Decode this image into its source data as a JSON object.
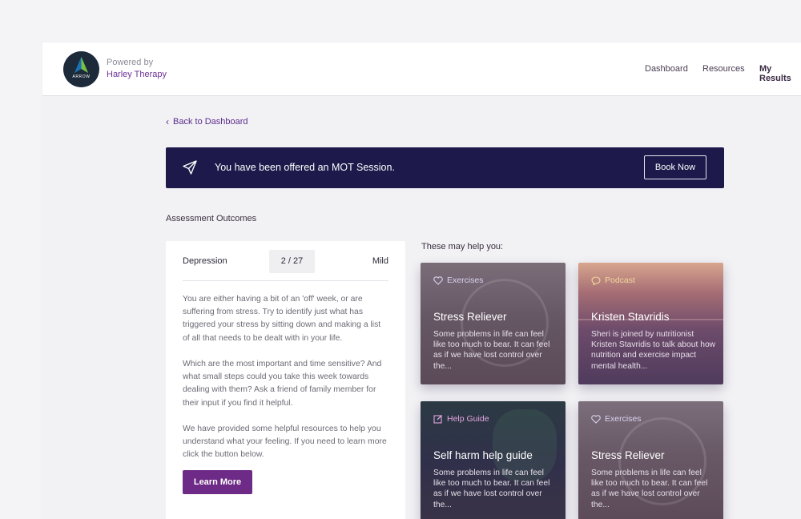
{
  "header": {
    "logo_text": "ARROW",
    "powered_by": "Powered by",
    "brand": "Harley Therapy",
    "nav": [
      {
        "label": "Dashboard"
      },
      {
        "label": "Resources"
      },
      {
        "label": "My Results"
      }
    ]
  },
  "back_link": "Back to Dashboard",
  "banner": {
    "icon": "paper-plane-icon",
    "text": "You have been offered an MOT Session.",
    "button": "Book Now"
  },
  "section_title": "Assessment Outcomes",
  "outcome": {
    "label": "Depression",
    "score": "2 / 27",
    "level": "Mild",
    "paragraphs": [
      "You are either having a bit of an 'off' week, or are suffering from stress. Try to identify just what has triggered your stress by sitting down and making a list of all that needs to be dealt with in your life.",
      "Which are the most important and time sensitive? And what small steps could you take this week towards dealing with them? Ask a friend of family member for their input if you find it helpful.",
      "We have provided some helpful resources to help you understand what your feeling. If you need to learn more click the button below."
    ],
    "button": "Learn More"
  },
  "help_title": "These may help you:",
  "resources": [
    {
      "tag": "Exercises",
      "tag_icon": "heart-icon",
      "tag_color": "#d9d3f2",
      "title": "Stress Reliever",
      "desc": "Some problems in life can feel like too much to bear. It can feel as if we have lost control over the..."
    },
    {
      "tag": "Podcast",
      "tag_icon": "speech-bubble-icon",
      "tag_color": "#f3d79c",
      "title": "Kristen Stavridis",
      "desc": "Sheri is joined by nutritionist Kristen Stavridis to talk about how nutrition and exercise impact mental health..."
    },
    {
      "tag": "Help Guide",
      "tag_icon": "edit-icon",
      "tag_color": "#e2a5de",
      "title": "Self harm help guide",
      "desc": "Some problems in life can feel like too much to bear. It can feel as if we have lost control over the..."
    },
    {
      "tag": "Exercises",
      "tag_icon": "heart-icon",
      "tag_color": "#d9d3f2",
      "title": "Stress Reliever",
      "desc": "Some problems in life can feel like too much to bear. It can feel as if we have lost control over the..."
    }
  ],
  "colors": {
    "brand_purple": "#6d2a86",
    "banner_navy": "#1d1a4b",
    "link_purple": "#5a2d8a"
  }
}
